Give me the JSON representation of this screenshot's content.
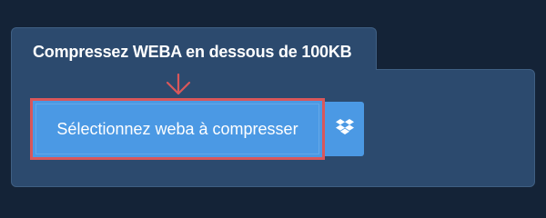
{
  "tab": {
    "title": "Compressez WEBA en dessous de 100KB"
  },
  "upload": {
    "select_label": "Sélectionnez weba à compresser",
    "dropbox_icon": "dropbox-icon",
    "arrow_icon": "arrow-down-icon"
  },
  "colors": {
    "background": "#142337",
    "panel": "#2c4a6e",
    "button": "#4b99e4",
    "highlight": "#d9575a"
  }
}
